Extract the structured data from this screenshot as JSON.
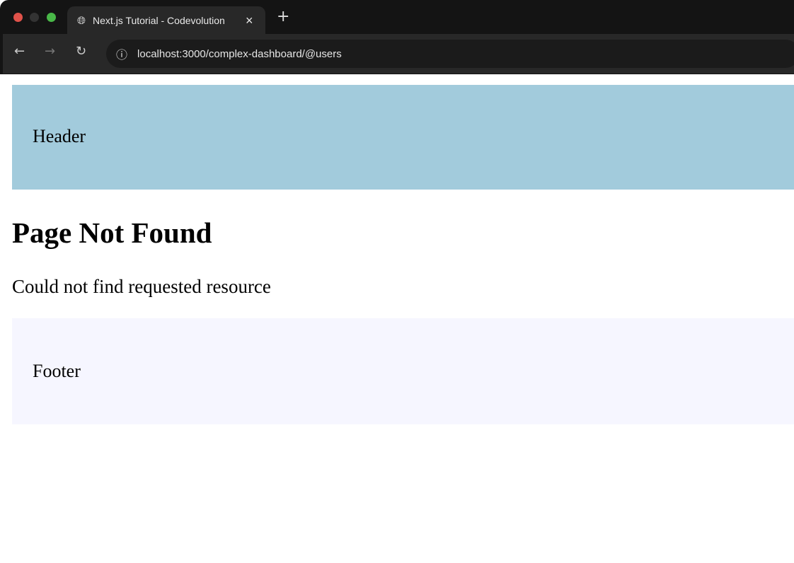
{
  "browser": {
    "tab_title": "Next.js Tutorial - Codevolution",
    "close": "×",
    "new_tab": "+",
    "url": "localhost:3000/complex-dashboard/@users",
    "back": "←",
    "forward": "→",
    "reload": "↻",
    "info": "ⓘ"
  },
  "page": {
    "header": "Header",
    "title": "Page Not Found",
    "message": "Could not find requested resource",
    "footer": "Footer"
  }
}
